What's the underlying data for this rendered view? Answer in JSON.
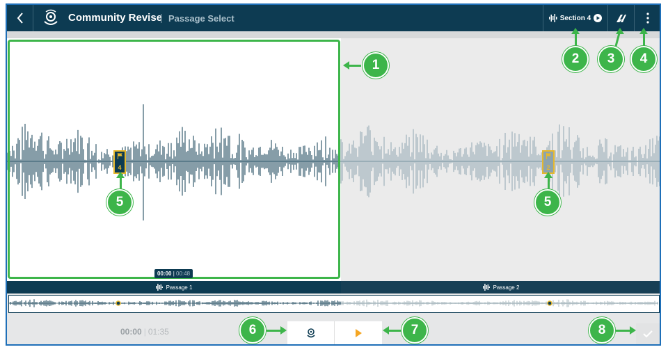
{
  "header": {
    "title": "Community Revise",
    "subtitle": "Passage Select",
    "section_label": "Section 4"
  },
  "waveform": {
    "current_time": "00:00",
    "total_time": "00:48",
    "markers": [
      {
        "number": "4"
      },
      {
        "number": "2"
      }
    ]
  },
  "passages": [
    {
      "label": "Passage 1"
    },
    {
      "label": "Passage 2"
    }
  ],
  "playback": {
    "current": "00:00",
    "total": "01:35"
  },
  "callouts": [
    "1",
    "2",
    "3",
    "4",
    "5",
    "5",
    "6",
    "7",
    "8"
  ],
  "colors": {
    "topbar": "#0d3b52",
    "accent_green": "#3db54a",
    "marker_gold": "#e5b82e",
    "play_orange": "#f5a623"
  }
}
